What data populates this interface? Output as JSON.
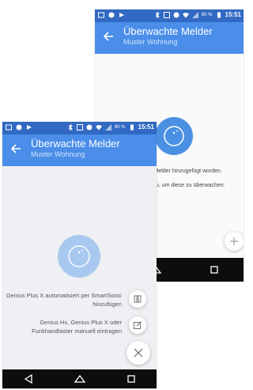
{
  "colors": {
    "statusbar": "#3169c3",
    "appbar": "#4a8ee9",
    "accent": "#4a90e2",
    "scrim": "#eef0f3"
  },
  "statusbar": {
    "battery": "60 %",
    "time": "15:51"
  },
  "appbar": {
    "title": "Überwachte Melder",
    "subtitle": "Muster Wohnung"
  },
  "background_screen": {
    "empty_line1": "Genius-Melder hinzugefügt worden.",
    "empty_line2": "er hinzu, um diese zu überwachen.",
    "fab_icon": "plus-icon"
  },
  "front_screen": {
    "menu": [
      {
        "line1": "Genius Plus X automatisiert per SmartSonic",
        "line2": "hinzufügen",
        "icon": "smartsonic-icon"
      },
      {
        "line1": "Genius Hx, Genius Plus X oder",
        "line2": "Funkhandtaster manuell eintragen",
        "icon": "edit-icon"
      }
    ],
    "close_icon": "close-icon"
  },
  "navbar": {
    "icons": [
      "back-nav-icon",
      "home-nav-icon",
      "recents-nav-icon"
    ]
  }
}
